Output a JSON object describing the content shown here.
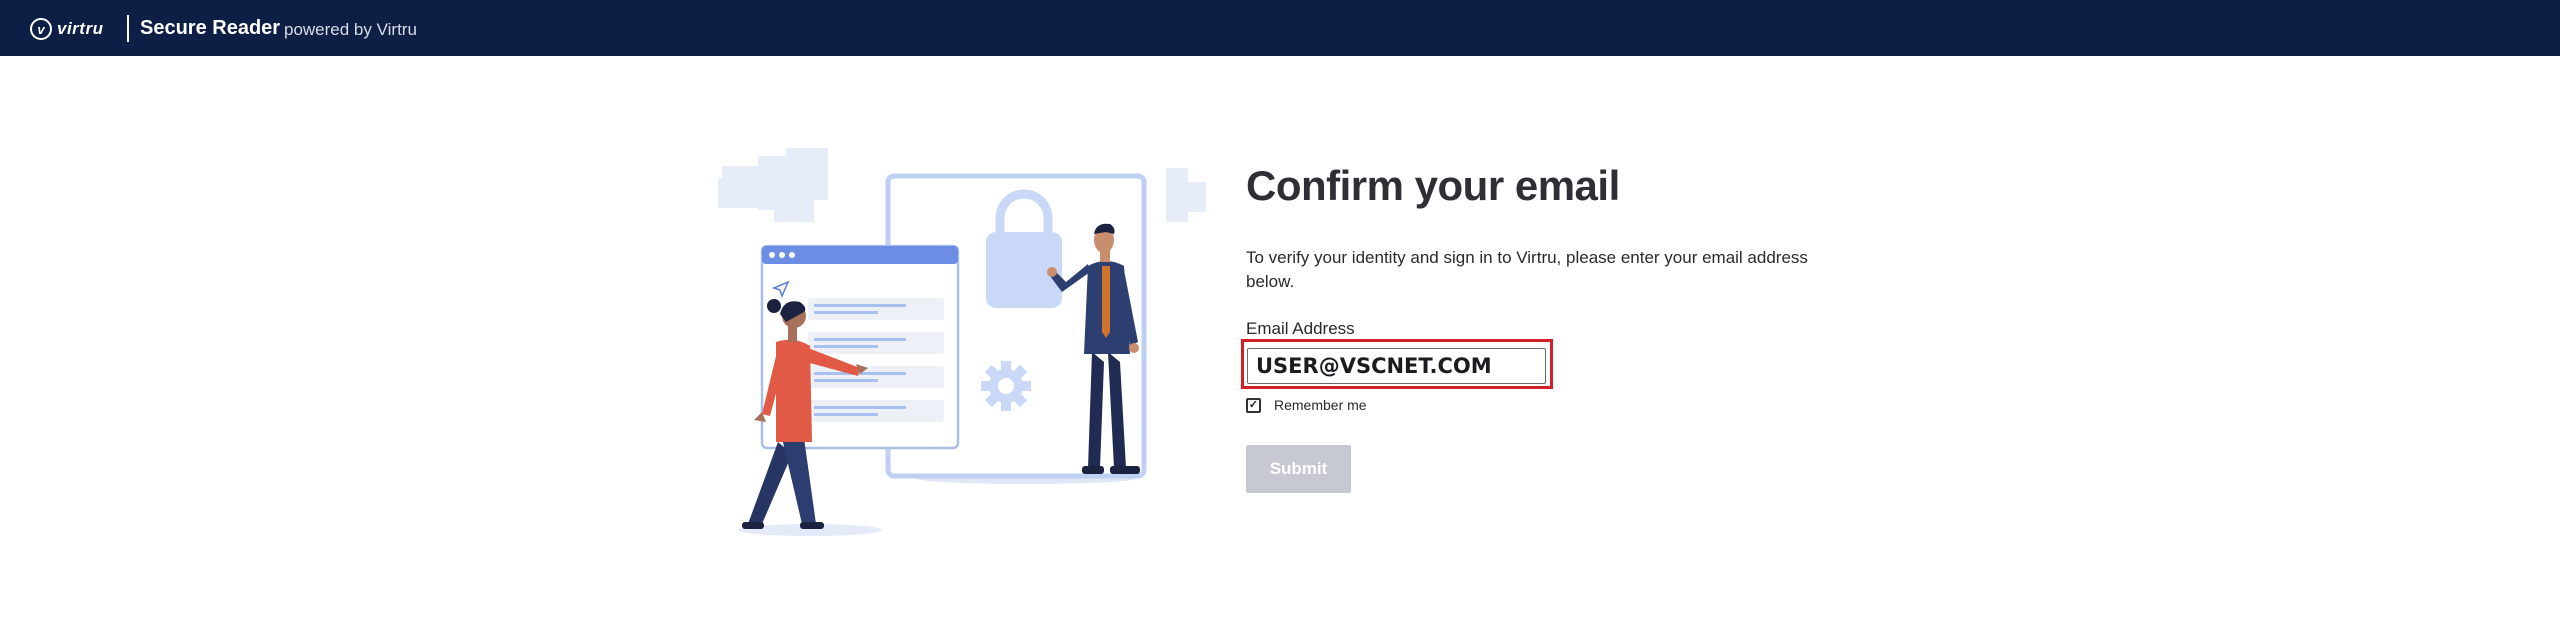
{
  "header": {
    "logo_glyph": "v",
    "logo_text": "virtru",
    "app_name": "Secure Reader",
    "powered_by": "powered by Virtru"
  },
  "main": {
    "title": "Confirm your email",
    "description": "To verify your identity and sign in to Virtru, please enter your email address below.",
    "email_label": "Email Address",
    "email_value": "USER@VSCNET.COM",
    "remember_label": "Remember me",
    "remember_checked": true,
    "submit_label": "Submit"
  },
  "colors": {
    "header_bg": "#0e1f45",
    "highlight_border": "#d21f2c",
    "submit_disabled_bg": "#c6c9d2"
  }
}
